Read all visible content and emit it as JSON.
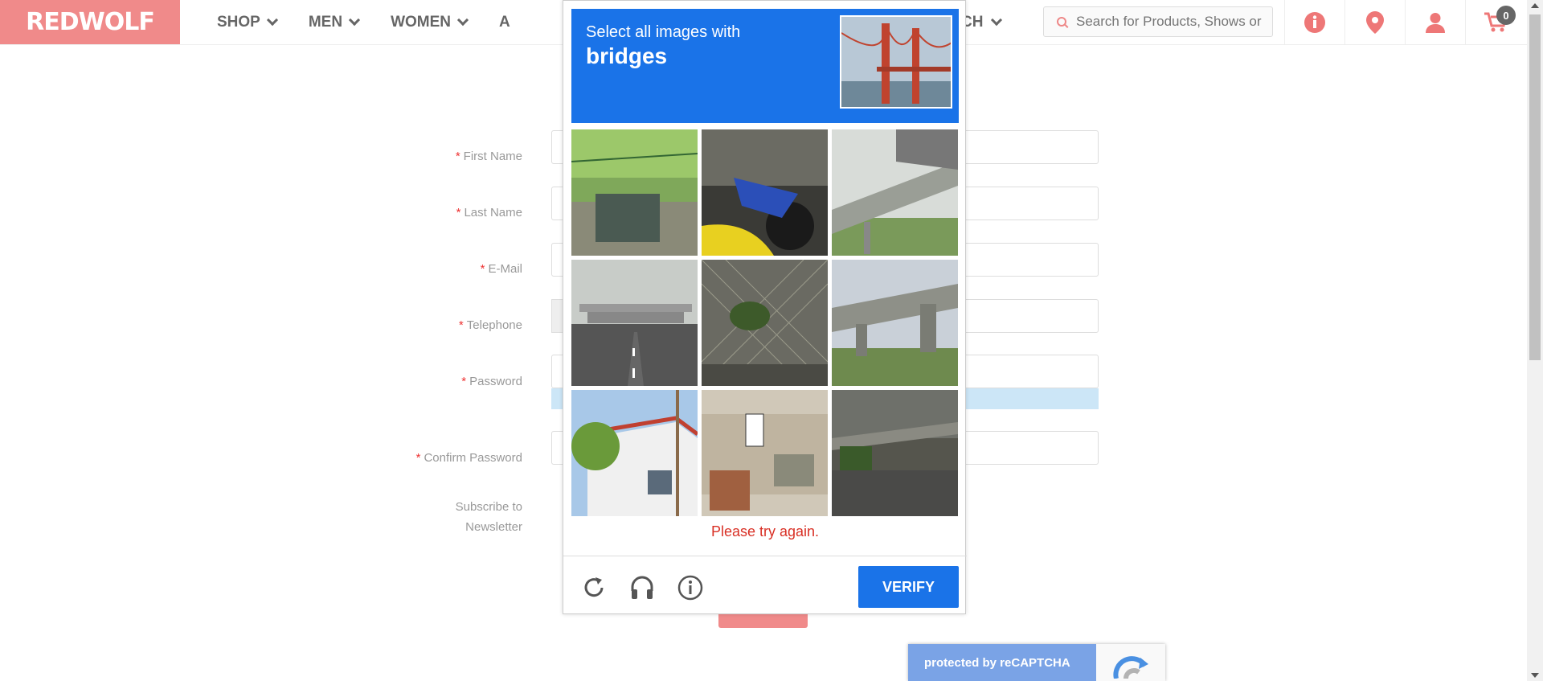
{
  "header": {
    "logo": "REDWOLF",
    "nav": [
      {
        "label": "SHOP"
      },
      {
        "label": "MEN"
      },
      {
        "label": "WOMEN"
      },
      {
        "label": "A"
      }
    ],
    "nav_tail": "CH",
    "search_placeholder": "Search for Products, Shows or",
    "cart_count": "0"
  },
  "form": {
    "required_mark": "*",
    "first_name": "First Name",
    "last_name": "Last Name",
    "email": "E-Mail",
    "telephone": "Telephone",
    "password": "Password",
    "confirm_password": "Confirm Password",
    "newsletter_line1": "Subscribe to",
    "newsletter_line2": "Newsletter"
  },
  "captcha": {
    "instruction": "Select all images with",
    "target": "bridges",
    "error": "Please try again.",
    "verify": "VERIFY",
    "tiles": [
      "tile-garden-fence",
      "tile-motorbike",
      "tile-overpass",
      "tile-highway-bridge",
      "tile-chainlink-fence",
      "tile-overpass-grass",
      "tile-house",
      "tile-street-sign",
      "tile-road-under-overpass"
    ]
  },
  "recaptcha_badge": {
    "text": "protected by reCAPTCHA"
  },
  "colors": {
    "brand": "#f08a8a",
    "captcha_blue": "#1a73e8",
    "error": "#d93025"
  }
}
